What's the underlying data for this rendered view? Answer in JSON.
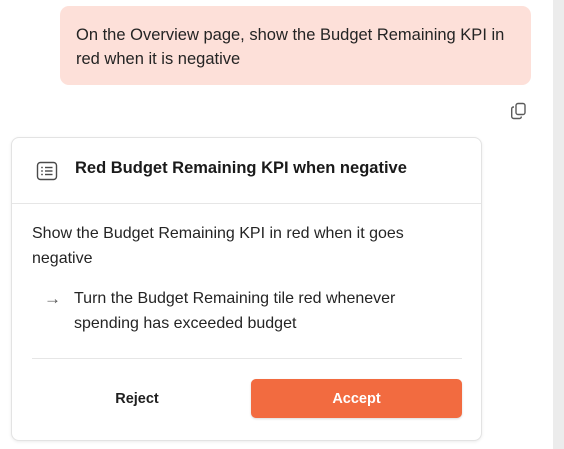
{
  "user_message": {
    "text": "On the Overview page, show the Budget Remaining KPI in red when it is negative"
  },
  "copy_button": {
    "icon": "copy-icon"
  },
  "plan_card": {
    "icon": "list-icon",
    "title": "Red Budget Remaining KPI when negative",
    "summary": "Show the Budget Remaining KPI in red when it goes negative",
    "steps": [
      {
        "arrow": "→",
        "text": "Turn the Budget Remaining tile red whenever spending has exceeded budget"
      }
    ],
    "reject_label": "Reject",
    "accept_label": "Accept"
  },
  "colors": {
    "user_bubble": "#fde0d9",
    "accept": "#f26b40"
  }
}
